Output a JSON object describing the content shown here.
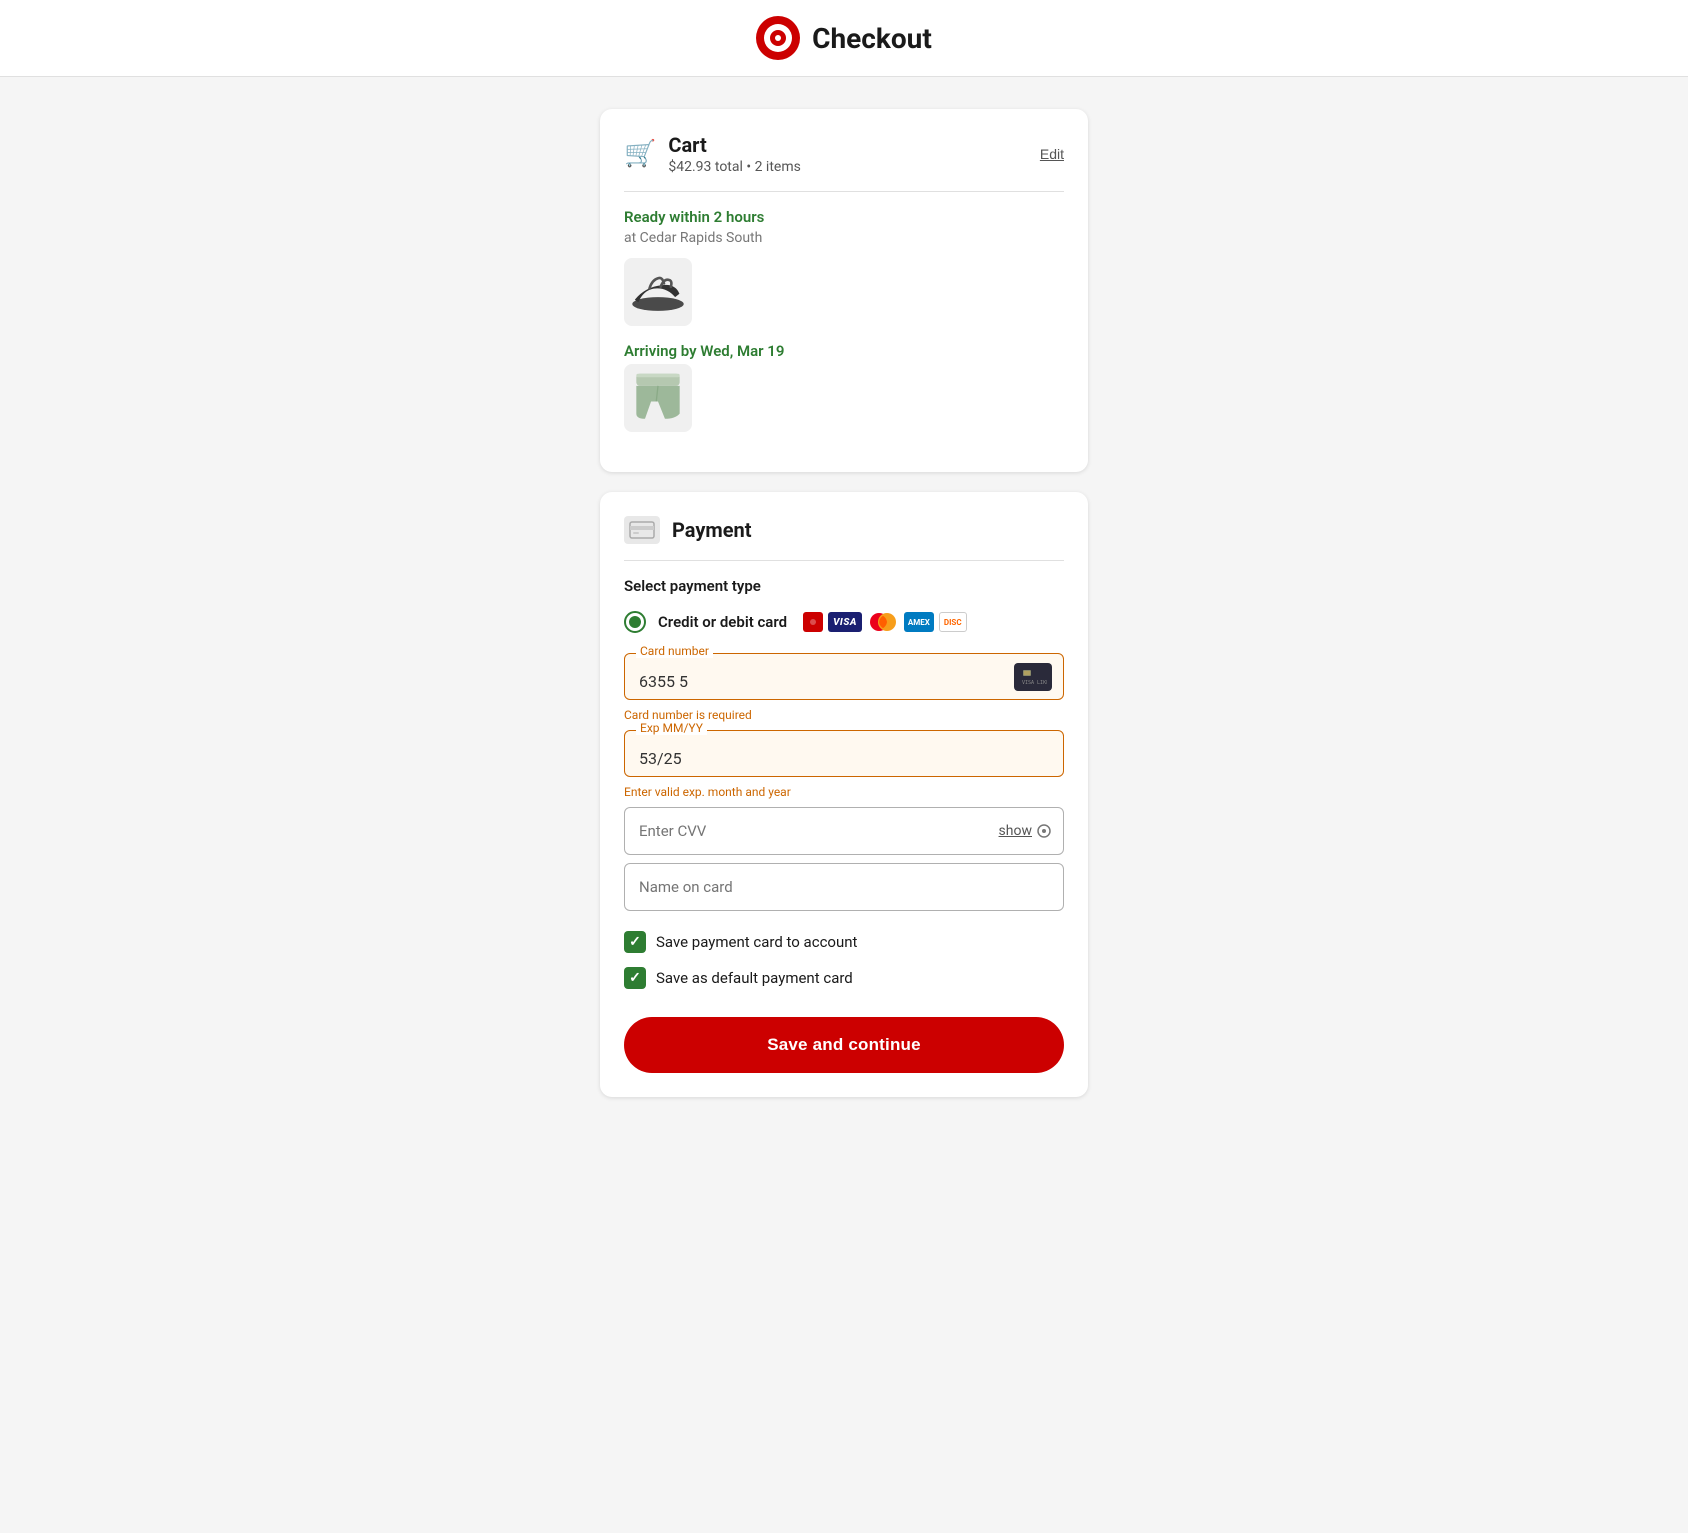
{
  "header": {
    "title": "Checkout"
  },
  "cart": {
    "title": "Cart",
    "subtitle": "$42.93 total • 2 items",
    "edit_label": "Edit",
    "delivery1": {
      "label": "Ready within 2 hours",
      "location": "at Cedar Rapids South"
    },
    "delivery2": {
      "label": "Arriving by Wed, Mar 19"
    }
  },
  "payment": {
    "title": "Payment",
    "section_label": "Select payment type",
    "option_label": "Credit or debit card",
    "card_number_label": "Card number",
    "card_number_value": "6355 5",
    "card_number_error": "Card number is required",
    "exp_label": "Exp MM/YY",
    "exp_value": "53/25",
    "exp_error": "Enter valid exp. month and year",
    "cvv_placeholder": "Enter CVV",
    "show_label": "show",
    "name_placeholder": "Name on card",
    "checkbox1_label": "Save payment card to account",
    "checkbox2_label": "Save as default payment card",
    "save_button_label": "Save and continue"
  }
}
